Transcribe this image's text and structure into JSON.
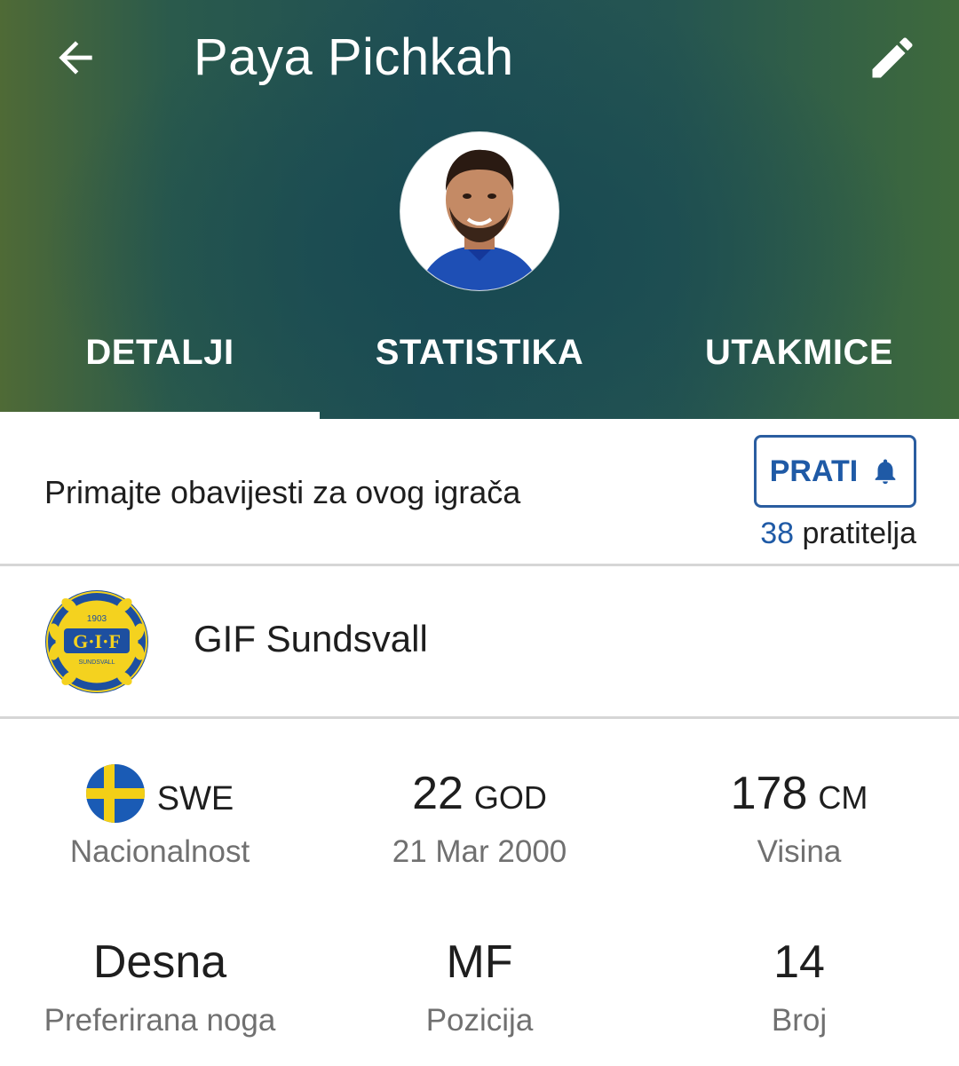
{
  "header": {
    "title": "Paya Pichkah",
    "back_icon": "arrow-left-icon",
    "edit_icon": "pencil-icon",
    "background_colors": [
      "#4f6a36",
      "#1f4f55",
      "#3f6a3c"
    ]
  },
  "tabs": [
    {
      "label": "DETALJI",
      "active": true
    },
    {
      "label": "STATISTIKA",
      "active": false
    },
    {
      "label": "UTAKMICE",
      "active": false
    }
  ],
  "notifications": {
    "text": "Primajte obavijesti za ovog igrača",
    "follow_button": "PRATI",
    "follow_icon": "bell-icon",
    "followers_count": "38",
    "followers_label": "pratitelja",
    "accent_color": "#1f5aa6"
  },
  "club": {
    "name": "GIF Sundsvall",
    "logo_lettering": "G·I·F 1903 SUNDSVALL"
  },
  "stats": {
    "nationality": {
      "code": "SWE",
      "label": "Nacionalnost",
      "flag_icon": "sweden-flag-icon"
    },
    "age": {
      "value": "22",
      "unit": "GOD",
      "sub": "21 Mar 2000"
    },
    "height": {
      "value": "178",
      "unit": "CM",
      "label": "Visina"
    },
    "foot": {
      "value": "Desna",
      "label": "Preferirana noga"
    },
    "position": {
      "value": "MF",
      "label": "Pozicija"
    },
    "number": {
      "value": "14",
      "label": "Broj"
    }
  }
}
